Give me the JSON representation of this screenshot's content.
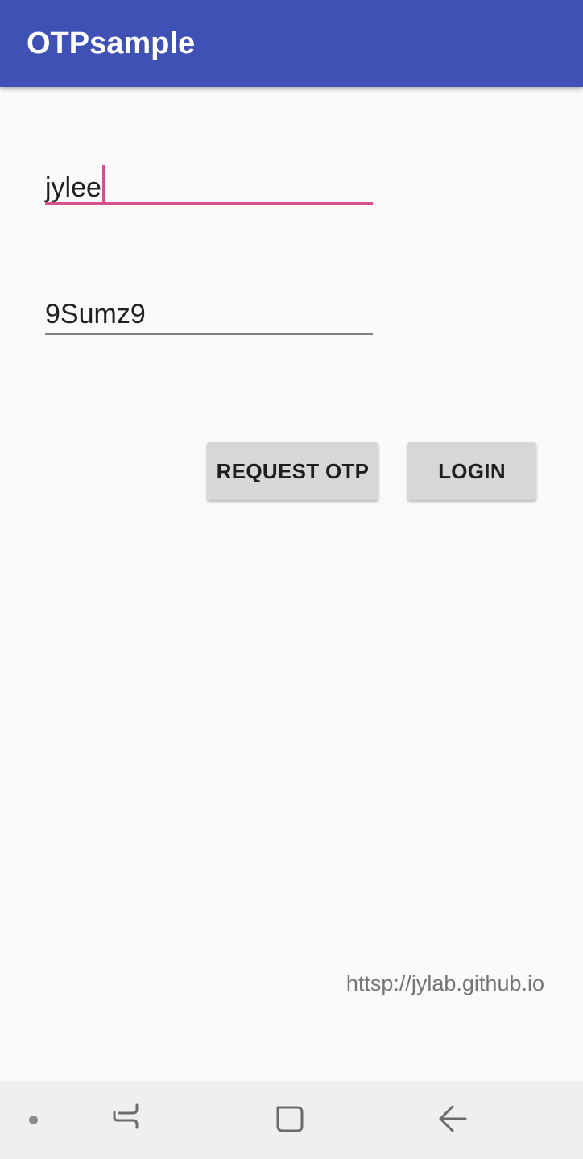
{
  "app_bar": {
    "title": "OTPsample",
    "color": "#3f51b5"
  },
  "form": {
    "username": {
      "value": "jylee",
      "focused": true,
      "accent_color": "#d6508a"
    },
    "otp": {
      "value": "9Sumz9"
    }
  },
  "buttons": {
    "request_otp_label": "REQUEST OTP",
    "login_label": "LOGIN"
  },
  "footer": {
    "link_text": "httsp://jylab.github.io"
  },
  "nav_bar": {
    "items": [
      "dot-indicator",
      "recent-apps-icon",
      "home-icon",
      "back-icon"
    ]
  }
}
